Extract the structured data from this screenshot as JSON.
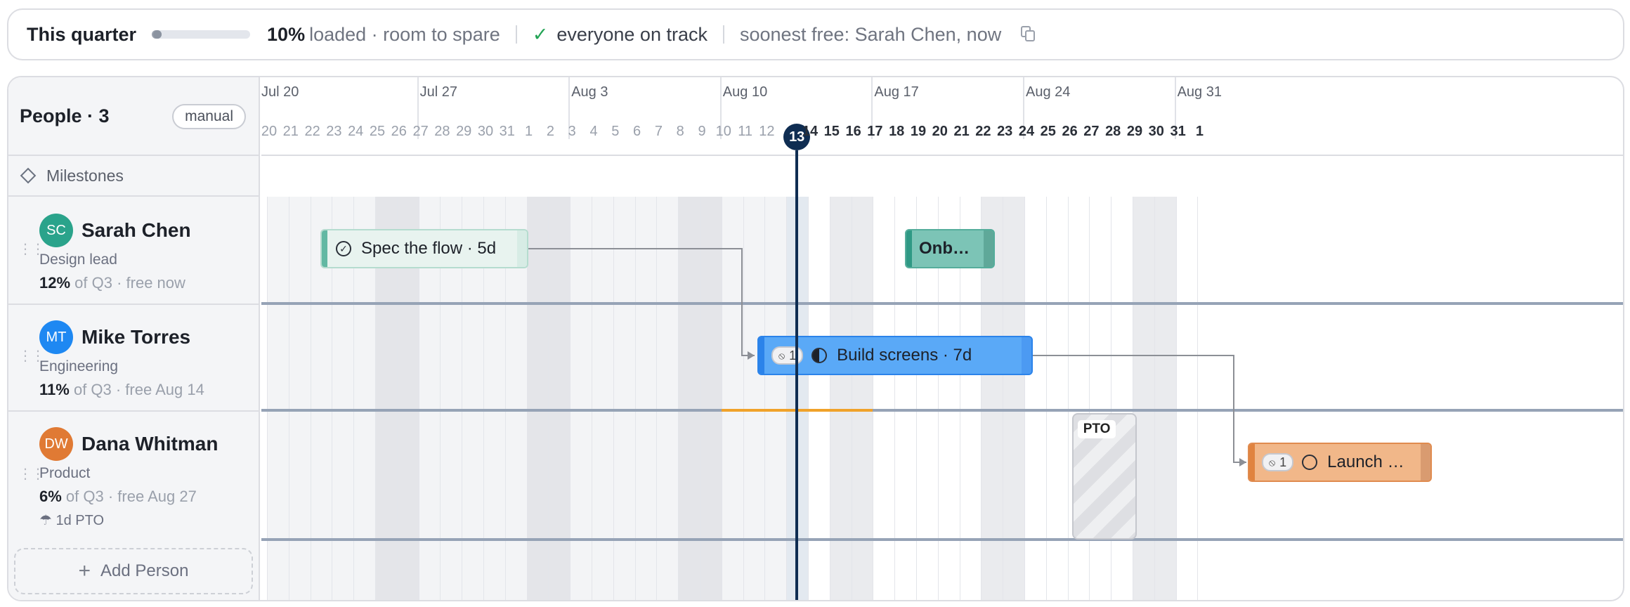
{
  "summary": {
    "title": "This quarter",
    "load_percent": "10%",
    "load_progress": 0.1,
    "load_suffix": "loaded · room to spare",
    "status": "everyone on track",
    "soonest_free": "soonest free: Sarah Chen, now"
  },
  "left": {
    "people_header": "People · 3",
    "sort_mode": "manual",
    "milestones_label": "Milestones",
    "add_person": "Add Person"
  },
  "people": [
    {
      "initials": "SC",
      "name": "Sarah Chen",
      "role": "Design lead",
      "load": "12%",
      "load_suffix": "of Q3 · free now",
      "color": "#2aa38b"
    },
    {
      "initials": "MT",
      "name": "Mike Torres",
      "role": "Engineering",
      "load": "11%",
      "load_suffix": "of Q3 · free Aug 14",
      "color": "#1e88f2"
    },
    {
      "initials": "DW",
      "name": "Dana Whitman",
      "role": "Product",
      "load": "6%",
      "load_suffix": "of Q3 · free Aug 27",
      "color": "#e07a34",
      "pto_note": "1d PTO"
    }
  ],
  "timeline": {
    "months": [
      "Jul 20",
      "Jul 27",
      "Aug 3",
      "Aug 10",
      "Aug 17",
      "Aug 24",
      "Aug 31"
    ],
    "days": [
      "20",
      "21",
      "22",
      "23",
      "24",
      "25",
      "26",
      "27",
      "28",
      "29",
      "30",
      "31",
      "1",
      "2",
      "3",
      "4",
      "5",
      "6",
      "7",
      "8",
      "9",
      "10",
      "11",
      "12",
      "13",
      "14",
      "15",
      "16",
      "17",
      "18",
      "19",
      "20",
      "21",
      "22",
      "23",
      "24",
      "25",
      "26",
      "27",
      "28",
      "29",
      "30",
      "31",
      "1"
    ],
    "today_label": "13"
  },
  "tasks": [
    {
      "label": "Spec the flow · 5d",
      "status_icon": "check-circle-icon",
      "owner": "Sarah Chen",
      "color": "#e8f3ef"
    },
    {
      "label": "Onb…",
      "owner": "Sarah Chen",
      "color": "#7cc4b6"
    },
    {
      "label": "Build screens · 7d",
      "status_icon": "half-circle-icon",
      "blocked_count": "1",
      "owner": "Mike Torres",
      "color": "#5aa9f7"
    },
    {
      "label": "Launch …",
      "status_icon": "empty-circle-icon",
      "blocked_count": "1",
      "owner": "Dana Whitman",
      "color": "#f1b789"
    }
  ],
  "pto": {
    "label": "PTO",
    "owner": "Dana Whitman"
  }
}
